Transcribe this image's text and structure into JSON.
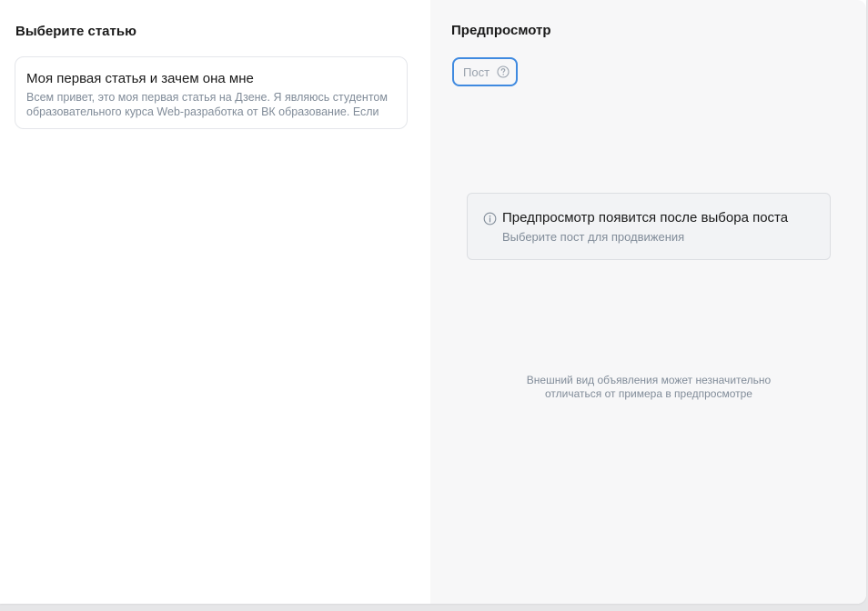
{
  "left_panel": {
    "title": "Выберите статью",
    "articles": [
      {
        "title": "Моя первая статья и зачем она мне",
        "excerpt": "Всем привет, это моя первая статья на Дзене. Я являюсь студентом образовательного курса Web-разработка от ВК образование. Если"
      }
    ]
  },
  "right_panel": {
    "title": "Предпросмотр",
    "tabs": [
      {
        "label": "Пост",
        "icon": "question-circle-icon"
      }
    ],
    "info": {
      "icon": "info-circle-icon",
      "title": "Предпросмотр появится после выбора поста",
      "subtitle": "Выберите пост для продвижения"
    },
    "disclaimer_line1": "Внешний вид объявления может незначительно",
    "disclaimer_line2": "отличаться от примера в предпросмотре"
  },
  "colors": {
    "accent": "#3f8ae0",
    "secondary_text": "#818c99",
    "preview_bg": "#f7f7f8"
  }
}
